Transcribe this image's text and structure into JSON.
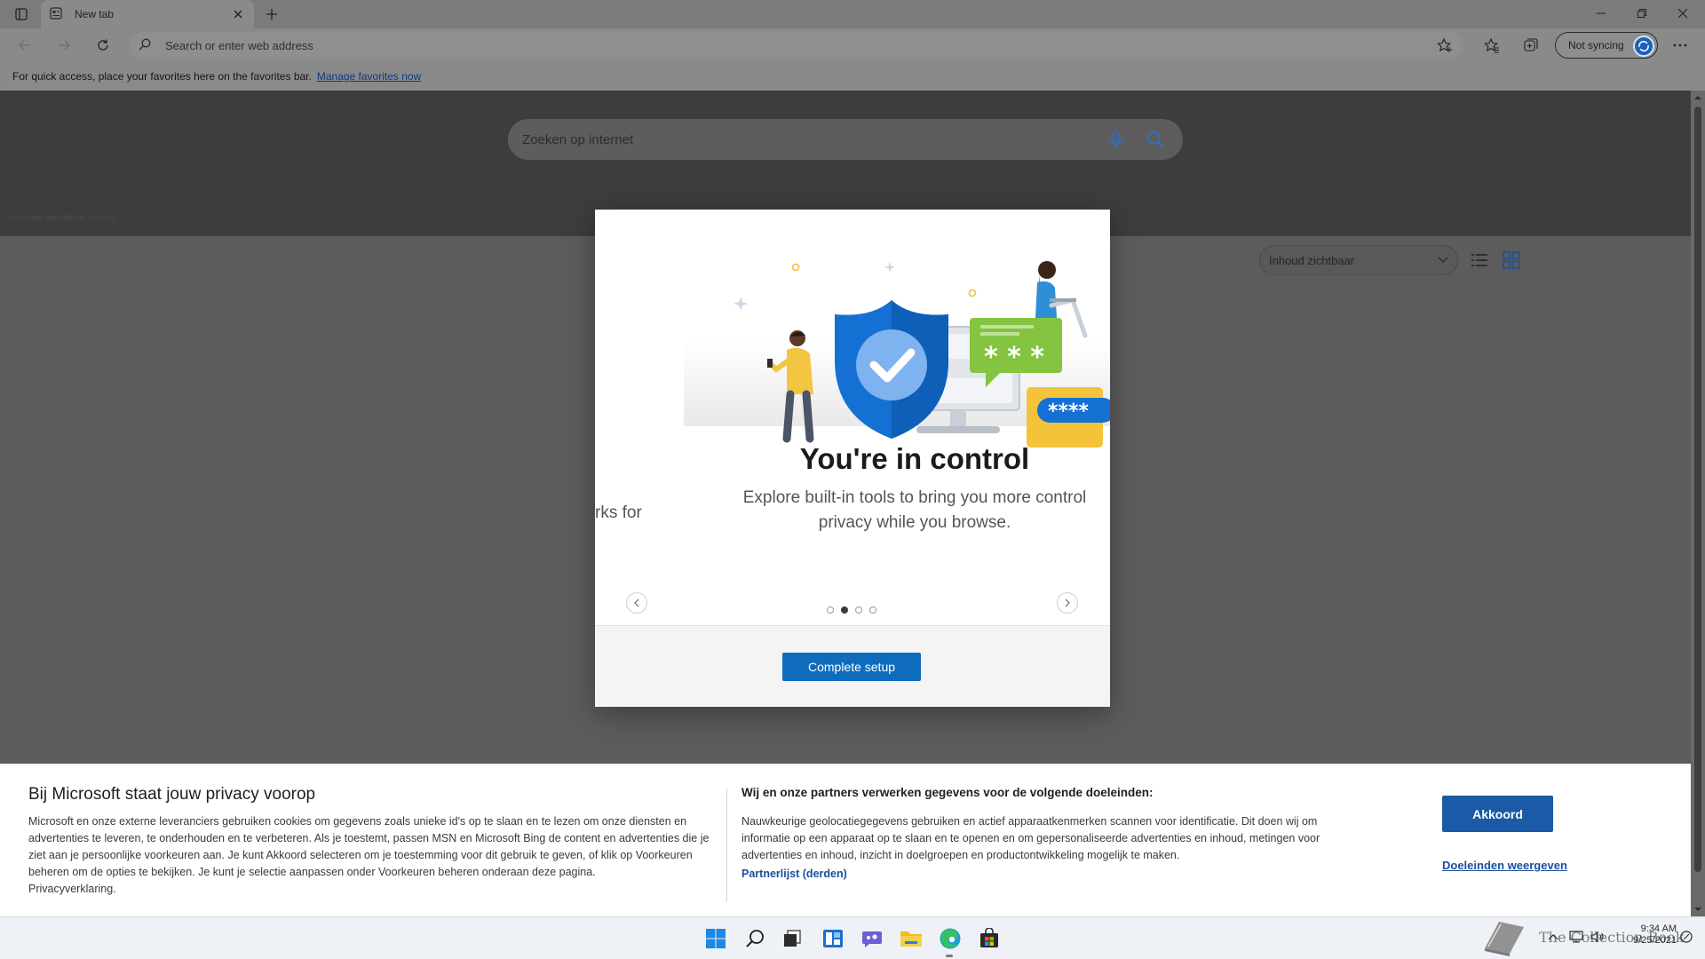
{
  "browser": {
    "tab_title": "New tab",
    "address_placeholder": "Search or enter web address",
    "sync_label": "Not syncing",
    "favorites_bar": {
      "message": "For quick access, place your favorites here on the favorites bar.",
      "link": "Manage favorites now"
    }
  },
  "ntp": {
    "search_placeholder": "Zoeken op internet",
    "quicklinks_label": "Snelkoppelingen",
    "cookies_info": "Informatie betreffende cookies",
    "content_visibility": "Inhoud zichtbaar"
  },
  "modal": {
    "title": "You're in control",
    "body_line1": "Explore built-in tools to bring you more control",
    "body_line2": "privacy while you browse.",
    "prev_slide_fragment": "rks for",
    "card_mask": "* * *",
    "card_mask_lock": "****",
    "dots_count": 4,
    "active_dot": 1,
    "complete_button": "Complete setup"
  },
  "privacy": {
    "heading": "Bij Microsoft staat jouw privacy voorop",
    "body": "Microsoft en onze externe leveranciers gebruiken cookies om gegevens zoals unieke id's op te slaan en te lezen om onze diensten en advertenties te leveren, te onderhouden en te verbeteren. Als je toestemt, passen MSN en Microsoft Bing de content en advertenties die je ziet aan je persoonlijke voorkeuren aan. Je kunt Akkoord selecteren om je toestemming voor dit gebruik te geven, of klik op Voorkeuren beheren om de opties te bekijken. Je kunt je selectie aanpassen onder Voorkeuren beheren onderaan deze pagina.",
    "privacy_link": "Privacyverklaring.",
    "partners_heading": "Wij en onze partners verwerken gegevens voor de volgende doeleinden:",
    "partners_body": "Nauwkeurige geolocatiegegevens gebruiken en actief apparaatkenmerken scannen voor identificatie. Dit doen wij om informatie op een apparaat op te slaan en te openen en om gepersonaliseerde advertenties en inhoud, metingen voor advertenties en inhoud, inzicht in doelgroepen en productontwikkeling mogelijk te maken.",
    "partners_link": "Partnerlijst (derden)",
    "accept_button": "Akkoord",
    "purposes_link": "Doeleinden weergeven"
  },
  "taskbar": {
    "apps": [
      "start-icon",
      "search-icon",
      "task-view-icon",
      "widgets-icon",
      "teams-chat-icon",
      "file-explorer-icon",
      "edge-icon",
      "store-icon"
    ],
    "time": "9:34 AM",
    "date": "9/25/2021",
    "watermark": "The Collection Book"
  },
  "colors": {
    "accent": "#0f6cbd",
    "accept_button": "#1a5aa6",
    "shield": "#1570d4",
    "card_green": "#84c441",
    "lock_yellow": "#f5c339"
  }
}
